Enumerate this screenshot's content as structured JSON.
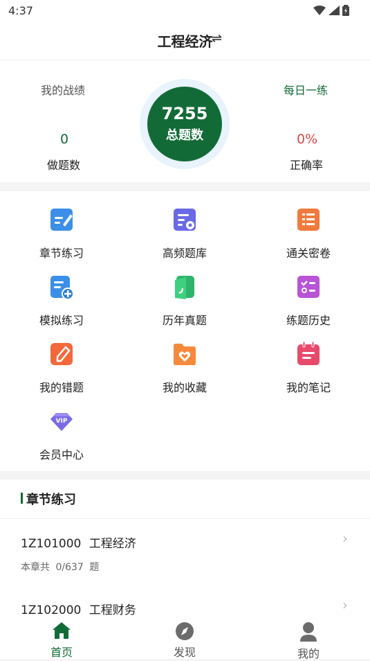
{
  "status": {
    "time": "4:37"
  },
  "header": {
    "title": "工程经济",
    "swap_glyph": "⇌"
  },
  "stats": {
    "record_label": "我的战绩",
    "daily_label": "每日一练",
    "done_count": "0",
    "done_label": "做题数",
    "total_count": "7255",
    "total_label": "总题数",
    "accuracy": "0%",
    "accuracy_label": "正确率"
  },
  "grid": {
    "items": [
      {
        "label": "章节练习",
        "icon": "chapter-practice-icon"
      },
      {
        "label": "高频题库",
        "icon": "frequent-bank-icon"
      },
      {
        "label": "通关密卷",
        "icon": "secret-paper-icon"
      },
      {
        "label": "模拟练习",
        "icon": "mock-practice-icon"
      },
      {
        "label": "历年真题",
        "icon": "past-exams-icon"
      },
      {
        "label": "练题历史",
        "icon": "history-icon"
      },
      {
        "label": "我的错题",
        "icon": "wrong-questions-icon"
      },
      {
        "label": "我的收藏",
        "icon": "favorites-icon"
      },
      {
        "label": "我的笔记",
        "icon": "notes-icon"
      },
      {
        "label": "会员中心",
        "icon": "vip-icon"
      }
    ]
  },
  "section": {
    "title": "章节练习",
    "rows": [
      {
        "code": "1Z101000",
        "name": "工程经济",
        "prefix": "本章共",
        "progress": "0/637",
        "suffix": "题"
      },
      {
        "code": "1Z102000",
        "name": "工程财务"
      }
    ]
  },
  "tabs": [
    {
      "label": "首页",
      "icon": "home-icon"
    },
    {
      "label": "发现",
      "icon": "compass-icon"
    },
    {
      "label": "我的",
      "icon": "profile-icon"
    }
  ],
  "colors": {
    "primary": "#126b37",
    "accuracy": "#e04848",
    "ring": "#e8f3fb"
  }
}
